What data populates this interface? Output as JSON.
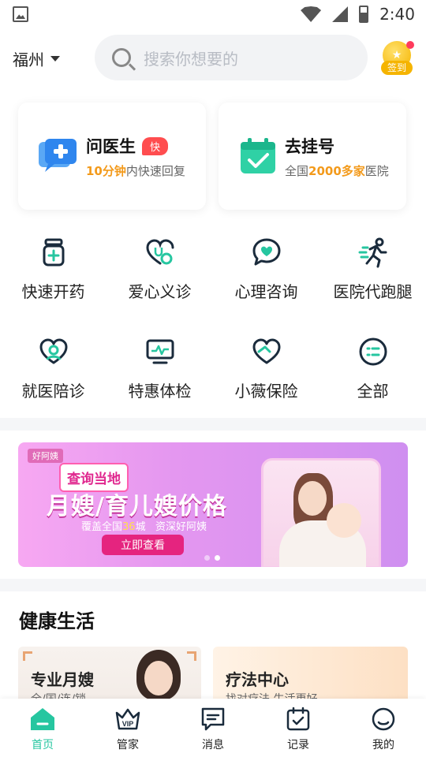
{
  "status_bar": {
    "time": "2:40"
  },
  "header": {
    "city": "福州",
    "search_placeholder": "搜索你想要的",
    "checkin_label": "签到"
  },
  "cards": [
    {
      "title": "问医生",
      "badge": "快",
      "sub_highlight": "10分钟",
      "sub_rest": "内快速回复"
    },
    {
      "title": "去挂号",
      "sub_prefix": "全国",
      "sub_highlight": "2000多家",
      "sub_rest": "医院"
    }
  ],
  "services": [
    {
      "label": "快速开药",
      "icon": "medicine-bottle-icon"
    },
    {
      "label": "爱心义诊",
      "icon": "heart-stethoscope-icon"
    },
    {
      "label": "心理咨询",
      "icon": "chat-heart-icon"
    },
    {
      "label": "医院代跑腿",
      "icon": "running-person-icon"
    },
    {
      "label": "就医陪诊",
      "icon": "accompany-heart-icon"
    },
    {
      "label": "特惠体检",
      "icon": "monitor-pulse-icon"
    },
    {
      "label": "小薇保险",
      "icon": "shield-heart-icon"
    },
    {
      "label": "全部",
      "icon": "all-services-icon"
    }
  ],
  "banner": {
    "brand": "好阿姨",
    "tag": "查询当地",
    "headline": "月嫂/育儿嫂价格",
    "sub_prefix": "覆盖全国",
    "sub_highlight": "36",
    "sub_mid": "城",
    "sub_rest": "资深好阿姨",
    "cta": "立即查看"
  },
  "health": {
    "title": "健康生活",
    "cards": [
      {
        "title": "专业月嫂",
        "sub": "全/国/连/锁"
      },
      {
        "title": "疗法中心",
        "sub": "找对疗法 生活更好"
      }
    ]
  },
  "tabbar": [
    {
      "label": "首页",
      "active": true
    },
    {
      "label": "管家",
      "active": false
    },
    {
      "label": "消息",
      "active": false
    },
    {
      "label": "记录",
      "active": false
    },
    {
      "label": "我的",
      "active": false
    }
  ],
  "colors": {
    "accent": "#26c6a0",
    "orange": "#f39a1b",
    "badge_red": "#ff4d4f"
  }
}
